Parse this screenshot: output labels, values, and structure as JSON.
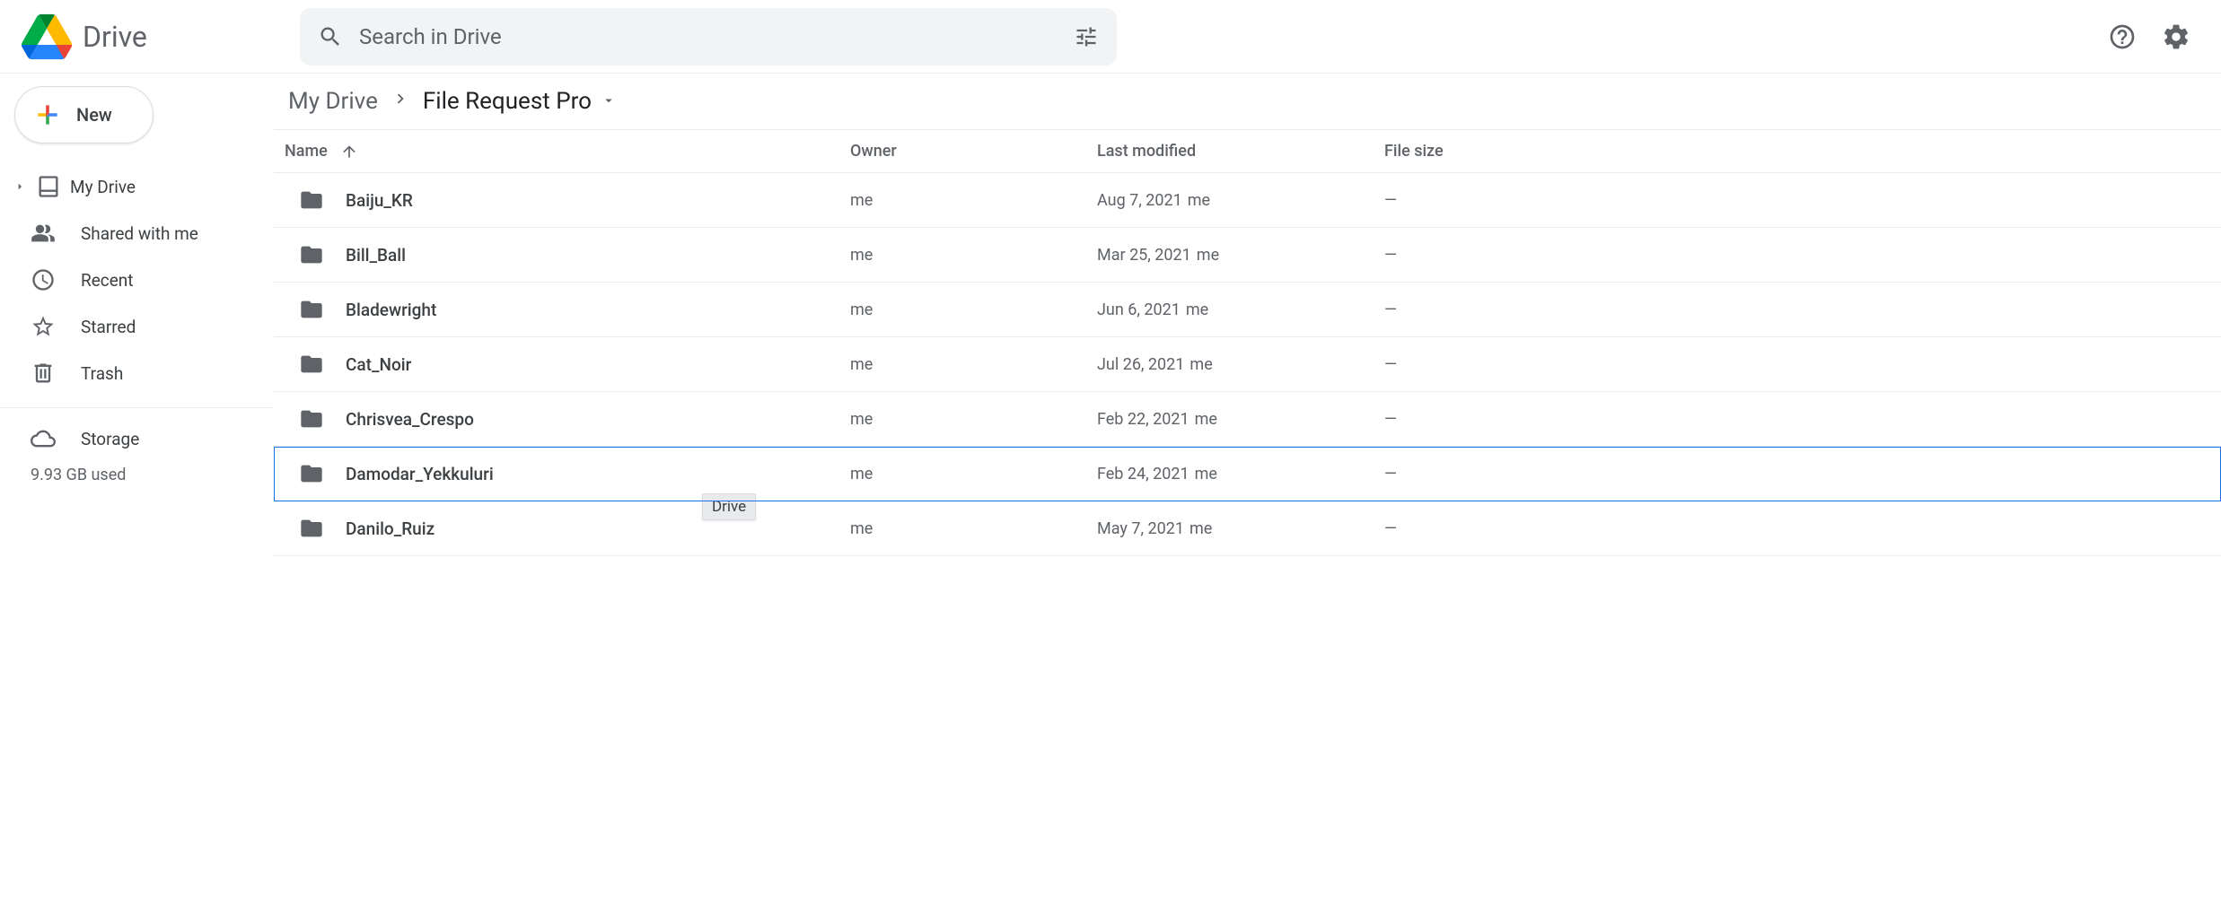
{
  "header": {
    "app_name": "Drive",
    "search_placeholder": "Search in Drive"
  },
  "sidebar": {
    "new_label": "New",
    "items": [
      {
        "label": "My Drive"
      },
      {
        "label": "Shared with me"
      },
      {
        "label": "Recent"
      },
      {
        "label": "Starred"
      },
      {
        "label": "Trash"
      }
    ],
    "storage_label": "Storage",
    "storage_used": "9.93 GB used"
  },
  "breadcrumb": {
    "root": "My Drive",
    "current": "File Request Pro"
  },
  "columns": {
    "name": "Name",
    "owner": "Owner",
    "modified": "Last modified",
    "size": "File size"
  },
  "rows": [
    {
      "name": "Baiju_KR",
      "owner": "me",
      "modified": "Aug 7, 2021",
      "modified_by": "me",
      "size": "—",
      "selected": false
    },
    {
      "name": "Bill_Ball",
      "owner": "me",
      "modified": "Mar 25, 2021",
      "modified_by": "me",
      "size": "—",
      "selected": false
    },
    {
      "name": "Bladewright",
      "owner": "me",
      "modified": "Jun 6, 2021",
      "modified_by": "me",
      "size": "—",
      "selected": false
    },
    {
      "name": "Cat_Noir",
      "owner": "me",
      "modified": "Jul 26, 2021",
      "modified_by": "me",
      "size": "—",
      "selected": false
    },
    {
      "name": "Chrisvea_Crespo",
      "owner": "me",
      "modified": "Feb 22, 2021",
      "modified_by": "me",
      "size": "—",
      "selected": false
    },
    {
      "name": "Damodar_Yekkuluri",
      "owner": "me",
      "modified": "Feb 24, 2021",
      "modified_by": "me",
      "size": "—",
      "selected": true
    },
    {
      "name": "Danilo_Ruiz",
      "owner": "me",
      "modified": "May 7, 2021",
      "modified_by": "me",
      "size": "—",
      "selected": false
    }
  ],
  "tooltip": "Drive"
}
